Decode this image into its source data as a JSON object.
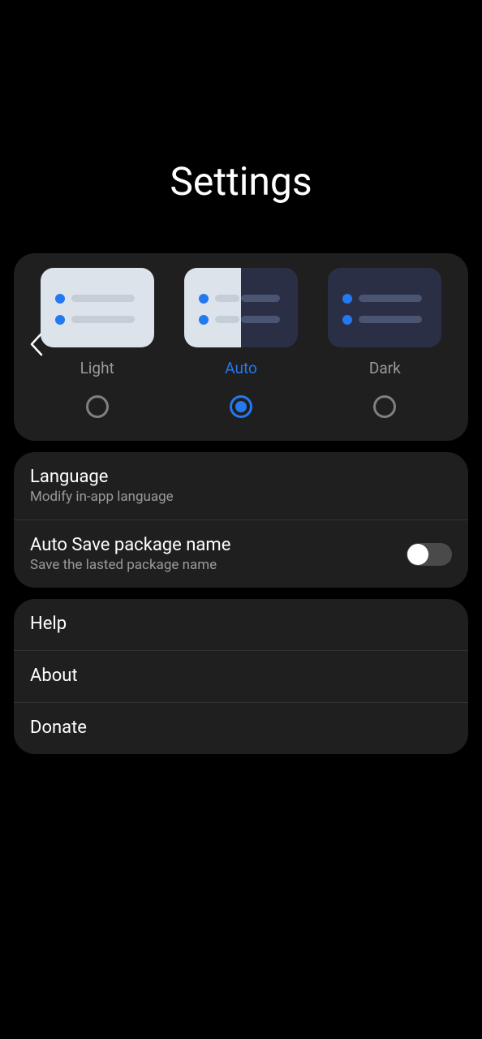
{
  "page": {
    "title": "Settings"
  },
  "theme": {
    "options": [
      {
        "label": "Light",
        "active": false
      },
      {
        "label": "Auto",
        "active": true
      },
      {
        "label": "Dark",
        "active": false
      }
    ]
  },
  "settings_group1": {
    "items": [
      {
        "title": "Language",
        "subtitle": "Modify in-app language"
      },
      {
        "title": "Auto Save package name",
        "subtitle": "Save the lasted package name",
        "toggle": false
      }
    ]
  },
  "settings_group2": {
    "items": [
      {
        "title": "Help"
      },
      {
        "title": "About"
      },
      {
        "title": "Donate"
      }
    ]
  }
}
